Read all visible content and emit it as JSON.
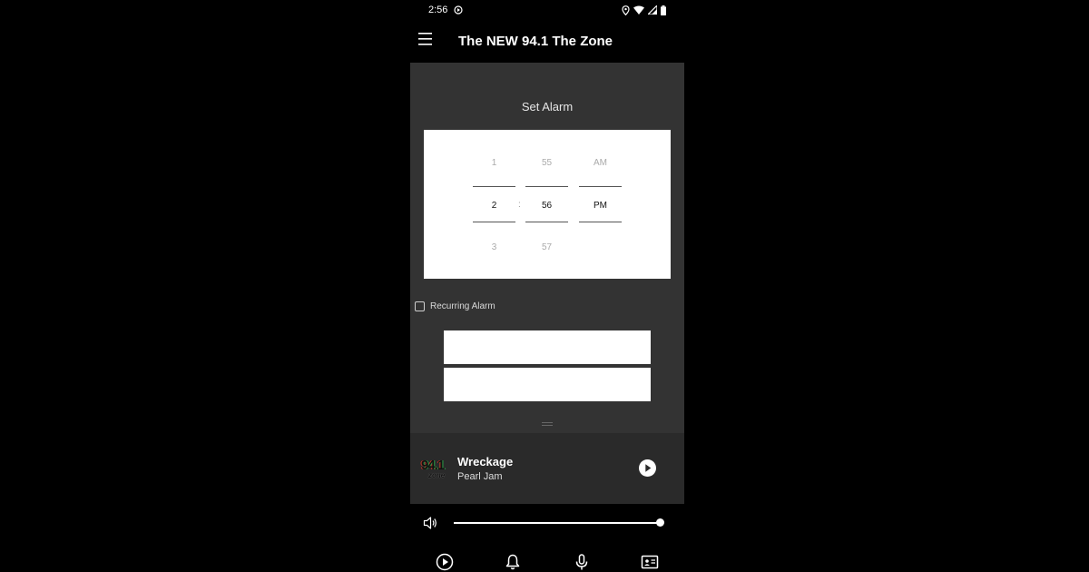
{
  "status_bar": {
    "time": "2:56",
    "icons": [
      "media-playing-icon",
      "location-icon",
      "wifi-icon",
      "signal-icon",
      "battery-icon"
    ]
  },
  "app_bar": {
    "title": "The NEW 94.1 The Zone",
    "menu_icon": "hamburger-menu-icon"
  },
  "alarm": {
    "title": "Set Alarm",
    "hour": {
      "prev": "1",
      "current": "2",
      "next": "3"
    },
    "minute": {
      "prev": "55",
      "current": "56",
      "next": "57"
    },
    "period": {
      "prev": "AM",
      "current": "PM"
    },
    "separator": ":",
    "recurring_label": "Recurring Alarm",
    "recurring_checked": false
  },
  "now_playing": {
    "logo": {
      "number": "94.1",
      "sub": "zone"
    },
    "title": "Wreckage",
    "artist": "Pearl Jam",
    "play_icon": "play-circle-icon"
  },
  "volume": {
    "icon": "speaker-icon",
    "level": 1.0
  },
  "bottom_nav": {
    "items": [
      "play-circle-icon",
      "bell-icon",
      "microphone-icon",
      "contact-card-icon"
    ]
  },
  "colors": {
    "background": "#000000",
    "panel": "#333333",
    "now_playing_bg": "#2a2a2a",
    "text": "#ffffff"
  }
}
